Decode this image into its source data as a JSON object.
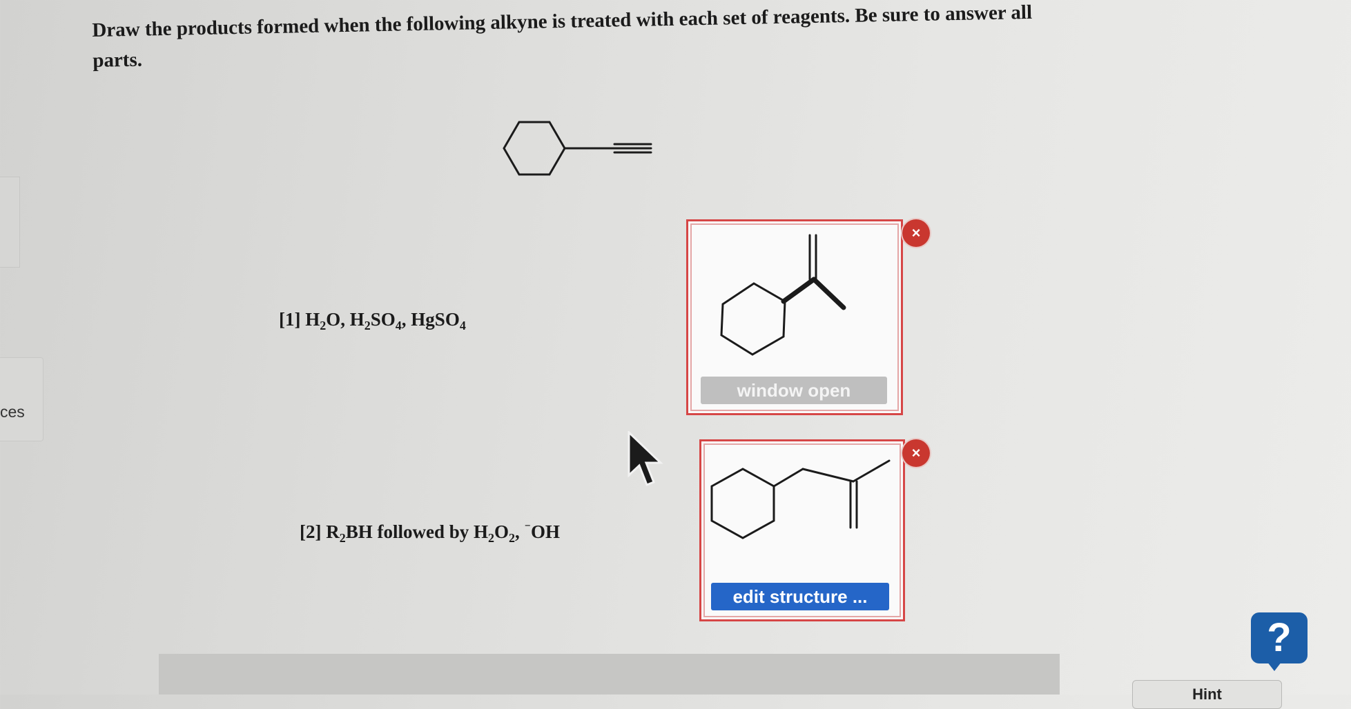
{
  "question": {
    "text": "Draw the products formed when the following alkyne is treated with each set of reagents. Be sure to answer all parts."
  },
  "sidebar": {
    "tab_label": "ces"
  },
  "parts": [
    {
      "label": "[1]",
      "reagents": "H2O, H2SO4, HgSO4",
      "button_label": "window open",
      "button_state": "disabled"
    },
    {
      "label": "[2]",
      "reagents": "R2BH followed by H2O2, ⁻OH",
      "button_label": "edit structure ...",
      "button_state": "enabled"
    }
  ],
  "controls": {
    "close_icon_text": "×",
    "help_text": "?",
    "hint_label": "Hint"
  },
  "icons": [
    "close-icon",
    "cursor-arrow-icon",
    "help-icon"
  ],
  "colors": {
    "box_border": "#d64646",
    "close_icon": "#c9372f",
    "primary_button": "#2566c8",
    "help_button": "#1c5ea8"
  }
}
